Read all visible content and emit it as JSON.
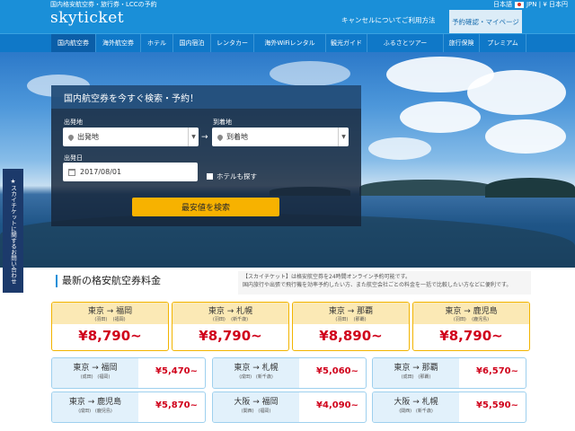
{
  "header": {
    "tagline": "国内格安航空券・旅行券・LCCの予約",
    "logo": "skyticket",
    "lang": "日本語",
    "region": "JPN | ¥ 日本円",
    "cancel_link": "キャンセルについて",
    "help_link": "ご利用方法",
    "mypage_label": "予約確認・マイページ"
  },
  "nav": [
    {
      "label": "国内航空券",
      "active": true
    },
    {
      "label": "海外航空券"
    },
    {
      "label": "ホテル"
    },
    {
      "label": "国内宿泊"
    },
    {
      "label": "レンタカー"
    },
    {
      "label": "海外WiFiレンタル"
    },
    {
      "label": "観光ガイド"
    },
    {
      "label": "ふるさとツアー"
    },
    {
      "label": "旅行保険"
    },
    {
      "label": "プレミアム"
    }
  ],
  "search": {
    "title": "国内航空券を今すぐ検索・予約！",
    "from_label": "出発地",
    "from_value": "出発地",
    "to_label": "到着地",
    "to_value": "到着地",
    "arrow": "→",
    "date_label": "出発日",
    "date_value": "2017/08/01",
    "hotel_label": "ホテルも探す",
    "button": "最安値を検索"
  },
  "side_tab": "スカイチケットに関するお問い合わせ",
  "section": {
    "title": "最新の格安航空券料金",
    "notice_line1": "【スカイチケット】は格安航空券を24時間オンライン予約可能です。",
    "notice_line2": "国内旅行や出張で飛行機を効率予約したい方、また航空会社ごとの料金を一括で比較したい方などに便利です。"
  },
  "featured_fares": [
    {
      "from": "東京",
      "to": "福岡",
      "from_sub": "(羽田)",
      "to_sub": "(福岡)",
      "price": "¥8,790~"
    },
    {
      "from": "東京",
      "to": "札幌",
      "from_sub": "(羽田)",
      "to_sub": "(新千歳)",
      "price": "¥8,790~"
    },
    {
      "from": "東京",
      "to": "那覇",
      "from_sub": "(羽田)",
      "to_sub": "(那覇)",
      "price": "¥8,890~"
    },
    {
      "from": "東京",
      "to": "鹿児島",
      "from_sub": "(羽田)",
      "to_sub": "(鹿児島)",
      "price": "¥8,790~"
    }
  ],
  "fares": [
    {
      "from": "東京",
      "to": "福岡",
      "from_sub": "(成田)",
      "to_sub": "(福岡)",
      "price": "¥5,470~"
    },
    {
      "from": "東京",
      "to": "札幌",
      "from_sub": "(成田)",
      "to_sub": "(新千歳)",
      "price": "¥5,060~"
    },
    {
      "from": "東京",
      "to": "那覇",
      "from_sub": "(成田)",
      "to_sub": "(那覇)",
      "price": "¥6,570~"
    },
    {
      "from": "東京",
      "to": "鹿児島",
      "from_sub": "(成田)",
      "to_sub": "(鹿児島)",
      "price": "¥5,870~"
    },
    {
      "from": "大阪",
      "to": "福岡",
      "from_sub": "(関西)",
      "to_sub": "(福岡)",
      "price": "¥4,090~"
    },
    {
      "from": "大阪",
      "to": "札幌",
      "from_sub": "(関西)",
      "to_sub": "(新千歳)",
      "price": "¥5,590~"
    }
  ],
  "colors": {
    "brand": "#1a8fd8",
    "nav": "#0f78c8",
    "accent": "#f7b200",
    "price": "#d0021b"
  },
  "icons": [
    "map-pin-icon",
    "calendar-icon",
    "chevron-down-icon",
    "flag-icon",
    "star-icon"
  ]
}
